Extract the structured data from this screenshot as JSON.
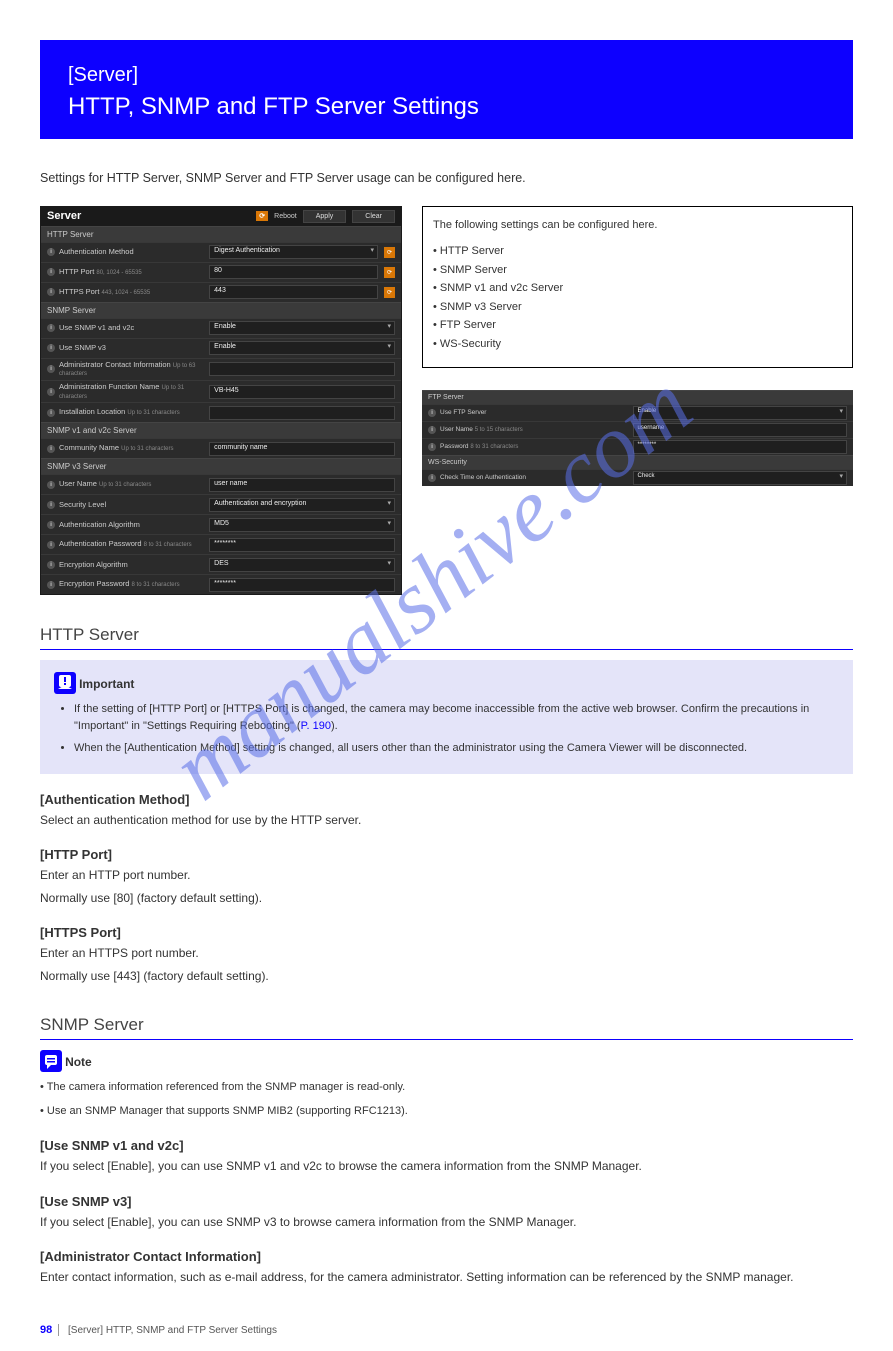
{
  "banner": {
    "sub": "[Server]",
    "main": "HTTP, SNMP and FTP Server Settings"
  },
  "intro": "Settings for HTTP Server, SNMP Server and FTP Server usage can be configured here.",
  "leftPanel": {
    "title": "Server",
    "rebootBadge": "⟳",
    "rebootLabel": "Reboot",
    "applyBtn": "Apply",
    "clearBtn": "Clear",
    "sections": [
      {
        "header": "HTTP Server",
        "rows": [
          {
            "label": "Authentication Method",
            "hint": "",
            "value": "Digest Authentication",
            "type": "select",
            "badge": true
          },
          {
            "label": "HTTP Port",
            "hint": "80, 1024 - 65535",
            "value": "80",
            "type": "input",
            "badge": true
          },
          {
            "label": "HTTPS Port",
            "hint": "443, 1024 - 65535",
            "value": "443",
            "type": "input",
            "badge": true
          }
        ]
      },
      {
        "header": "SNMP Server",
        "rows": [
          {
            "label": "Use SNMP v1 and v2c",
            "hint": "",
            "value": "Enable",
            "type": "select"
          },
          {
            "label": "Use SNMP v3",
            "hint": "",
            "value": "Enable",
            "type": "select"
          },
          {
            "label": "Administrator Contact Information",
            "hint": "Up to 63 characters",
            "value": "",
            "type": "input"
          },
          {
            "label": "Administration Function Name",
            "hint": "Up to 31 characters",
            "value": "VB-H45",
            "type": "input"
          },
          {
            "label": "Installation Location",
            "hint": "Up to 31 characters",
            "value": "",
            "type": "input"
          }
        ]
      },
      {
        "header": "SNMP v1 and v2c Server",
        "rows": [
          {
            "label": "Community Name",
            "hint": "Up to 31 characters",
            "value": "community name",
            "type": "input"
          }
        ]
      },
      {
        "header": "SNMP v3 Server",
        "rows": [
          {
            "label": "User Name",
            "hint": "Up to 31 characters",
            "value": "user name",
            "type": "input"
          },
          {
            "label": "Security Level",
            "hint": "",
            "value": "Authentication and encryption",
            "type": "select"
          },
          {
            "label": "Authentication Algorithm",
            "hint": "",
            "value": "MD5",
            "type": "select"
          },
          {
            "label": "Authentication Password",
            "hint": "8 to 31 characters",
            "value": "********",
            "type": "input"
          },
          {
            "label": "Encryption Algorithm",
            "hint": "",
            "value": "DES",
            "type": "select"
          },
          {
            "label": "Encryption Password",
            "hint": "8 to 31 characters",
            "value": "********",
            "type": "input"
          }
        ]
      }
    ]
  },
  "whiteBox": {
    "p1": "The following settings can be configured here.",
    "items": [
      "HTTP Server",
      "SNMP Server",
      "SNMP v1 and v2c Server",
      "SNMP v3 Server",
      "FTP Server",
      "WS-Security"
    ]
  },
  "smallPanel": {
    "sections": [
      {
        "header": "FTP Server",
        "rows": [
          {
            "label": "Use FTP Server",
            "hint": "",
            "value": "Enable",
            "type": "select"
          },
          {
            "label": "User Name",
            "hint": "5 to 15 characters",
            "value": "username",
            "type": "input"
          },
          {
            "label": "Password",
            "hint": "8 to 31 characters",
            "value": "********",
            "type": "input"
          }
        ]
      },
      {
        "header": "WS-Security",
        "rows": [
          {
            "label": "Check Time on Authentication",
            "hint": "",
            "value": "Check",
            "type": "select"
          }
        ]
      }
    ]
  },
  "httpSection": {
    "heading": "HTTP Server",
    "important": {
      "label": "Important",
      "bullets": [
        "If the setting of [HTTP Port] or [HTTPS Port] is changed, the camera may become inaccessible from the active web browser. Confirm the precautions in \"Important\" in \"Settings Requiring Rebooting\" (P. 190).",
        "When the [Authentication Method] setting is changed, all users other than the administrator using the Camera Viewer will be disconnected."
      ]
    },
    "items": [
      {
        "title": "[Authentication Method]",
        "body": "Select an authentication method for use by the HTTP server."
      },
      {
        "title": "[HTTP Port]",
        "body": "Enter an HTTP port number.\nNormally use [80] (factory default setting)."
      },
      {
        "title": "[HTTPS Port]",
        "body": "Enter an HTTPS port number.\nNormally use [443] (factory default setting)."
      }
    ]
  },
  "snmpSection": {
    "heading": "SNMP Server",
    "note": {
      "label": "Note",
      "lines": [
        "The camera information referenced from the SNMP manager is read-only.",
        "Use an SNMP Manager that supports SNMP MIB2 (supporting RFC1213)."
      ]
    },
    "items": [
      {
        "title": "[Use SNMP v1 and v2c]",
        "body": "If you select [Enable], you can use SNMP v1 and v2c to browse the camera information from the SNMP Manager."
      },
      {
        "title": "[Use SNMP v3]",
        "body": "If you select [Enable], you can use SNMP v3 to browse camera information from the SNMP Manager."
      },
      {
        "title": "[Administrator Contact Information]",
        "body": "Enter contact information, such as e-mail address, for the camera administrator. Setting information can be referenced by the SNMP manager."
      }
    ]
  },
  "footer": {
    "pageNum": "98",
    "text": "[Server] HTTP, SNMP and FTP Server Settings"
  },
  "watermark": "manualshive.com"
}
